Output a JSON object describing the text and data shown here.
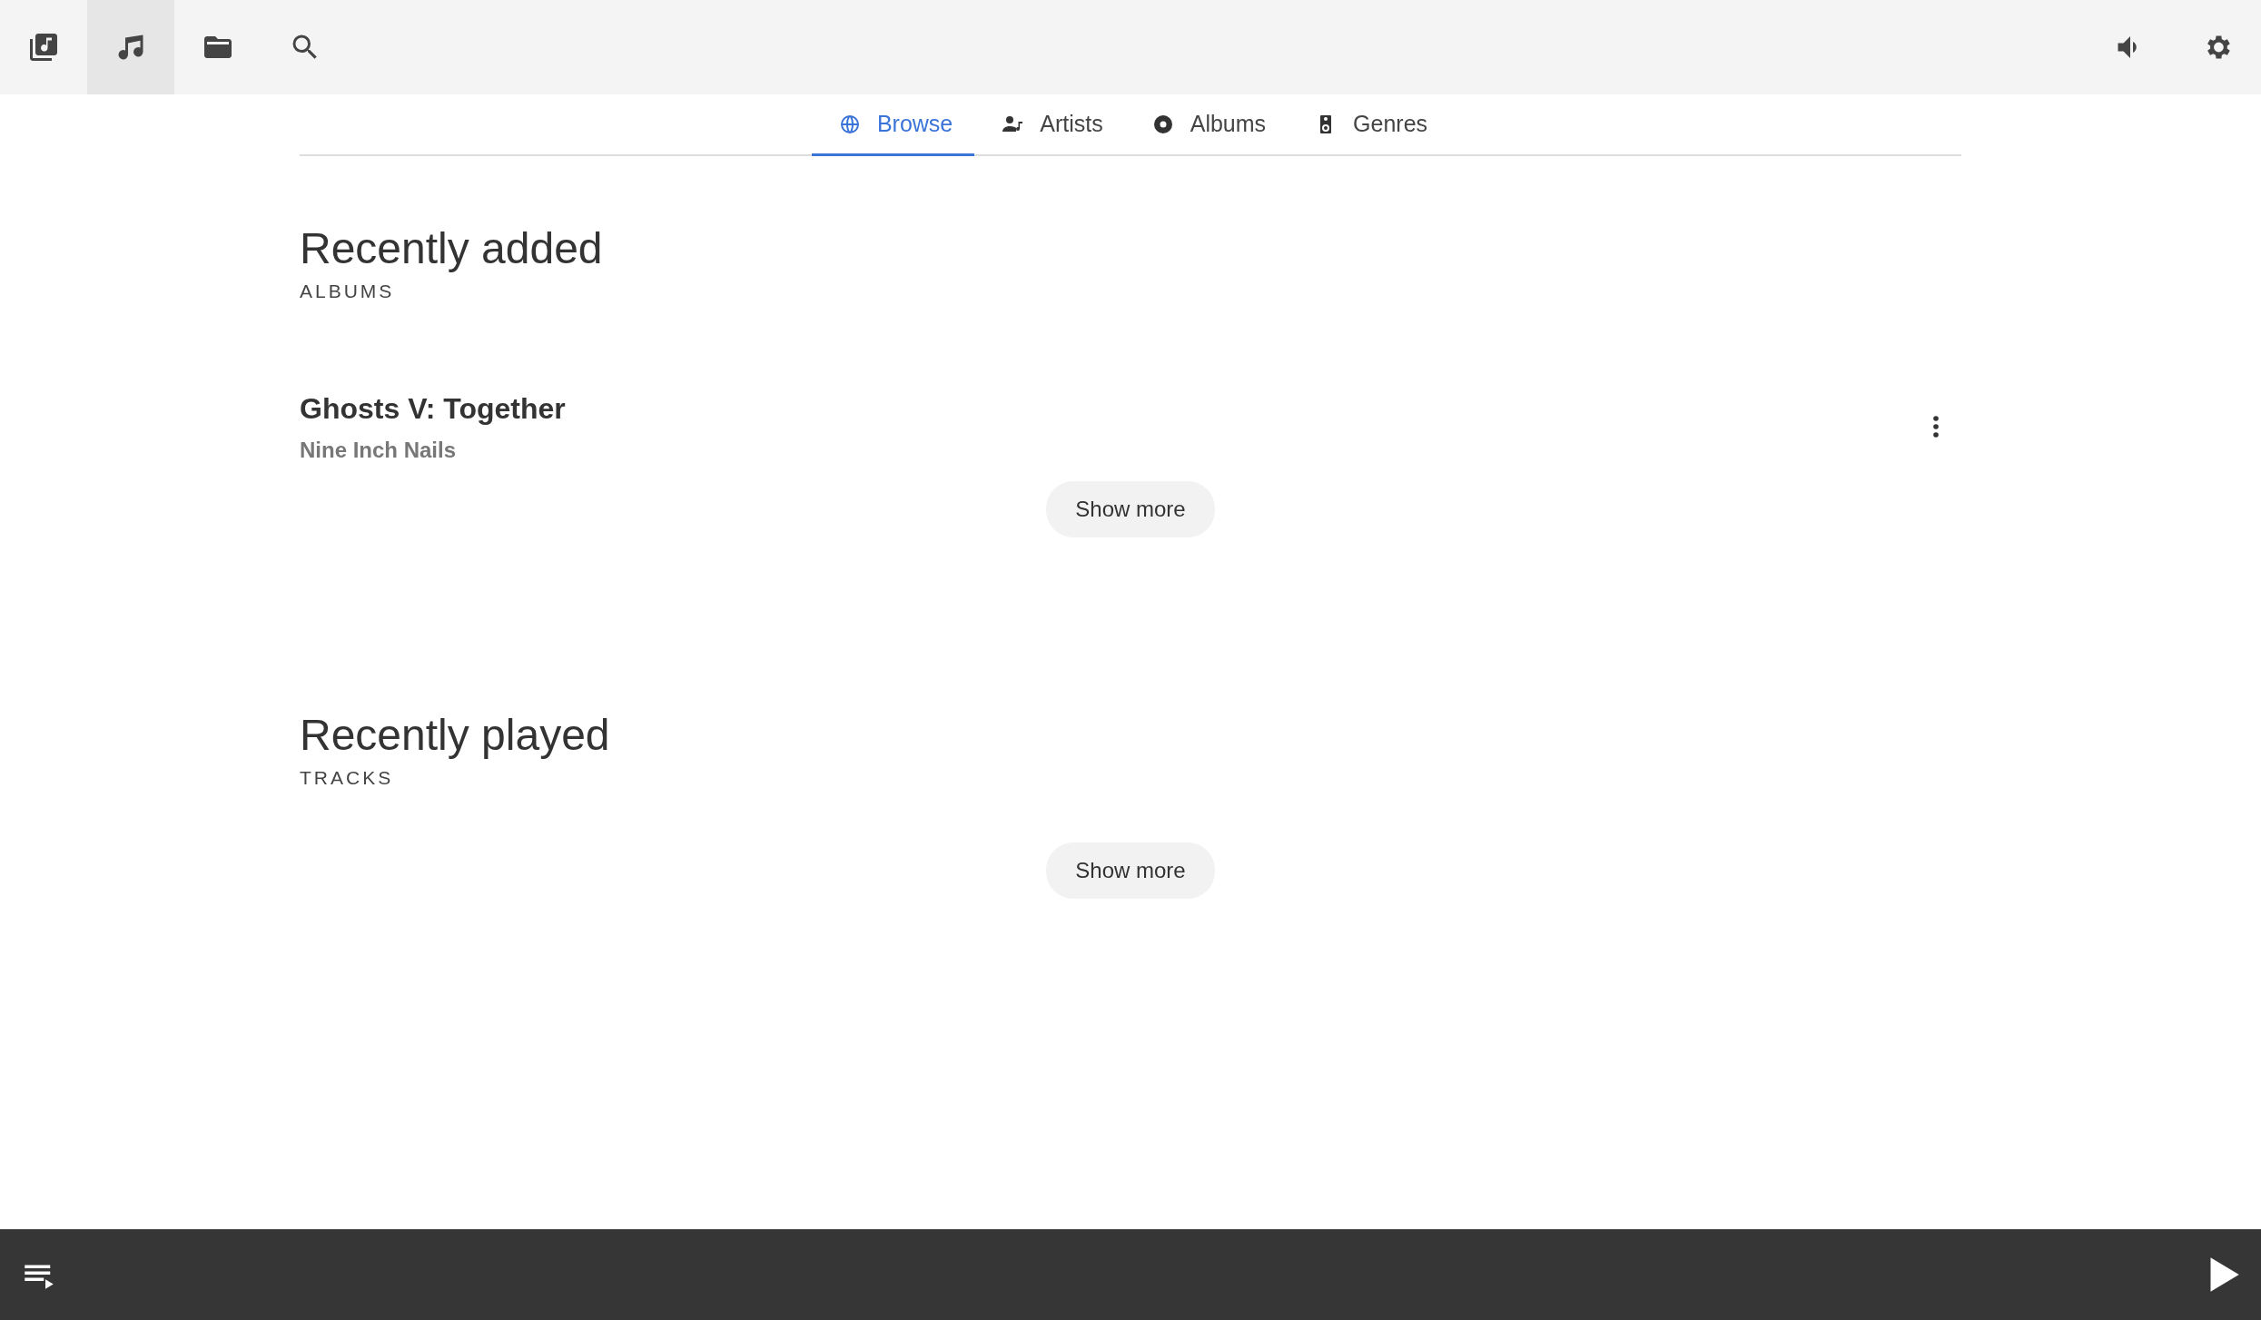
{
  "top_bar": {
    "nav_buttons": [
      {
        "kind": "library",
        "selected": false
      },
      {
        "kind": "music",
        "selected": true
      },
      {
        "kind": "folder",
        "selected": false
      },
      {
        "kind": "search",
        "selected": false
      }
    ],
    "right_buttons": [
      {
        "kind": "volume"
      },
      {
        "kind": "settings"
      }
    ]
  },
  "tabs": [
    {
      "kind": "globe",
      "label": "Browse",
      "selected": true
    },
    {
      "kind": "artist",
      "label": "Artists",
      "selected": false
    },
    {
      "kind": "disc",
      "label": "Albums",
      "selected": false
    },
    {
      "kind": "speaker",
      "label": "Genres",
      "selected": false
    }
  ],
  "sections": [
    {
      "title": "Recently added",
      "subtitle": "ALBUMS",
      "items": [
        {
          "title": "Ghosts V: Together",
          "artist": "Nine Inch Nails"
        }
      ],
      "button": "Show more"
    },
    {
      "title": "Recently played",
      "subtitle": "TRACKS",
      "button": "Show more"
    }
  ],
  "player_bar": {
    "buttons": [
      {
        "kind": "queue"
      },
      {
        "kind": "play"
      }
    ]
  }
}
